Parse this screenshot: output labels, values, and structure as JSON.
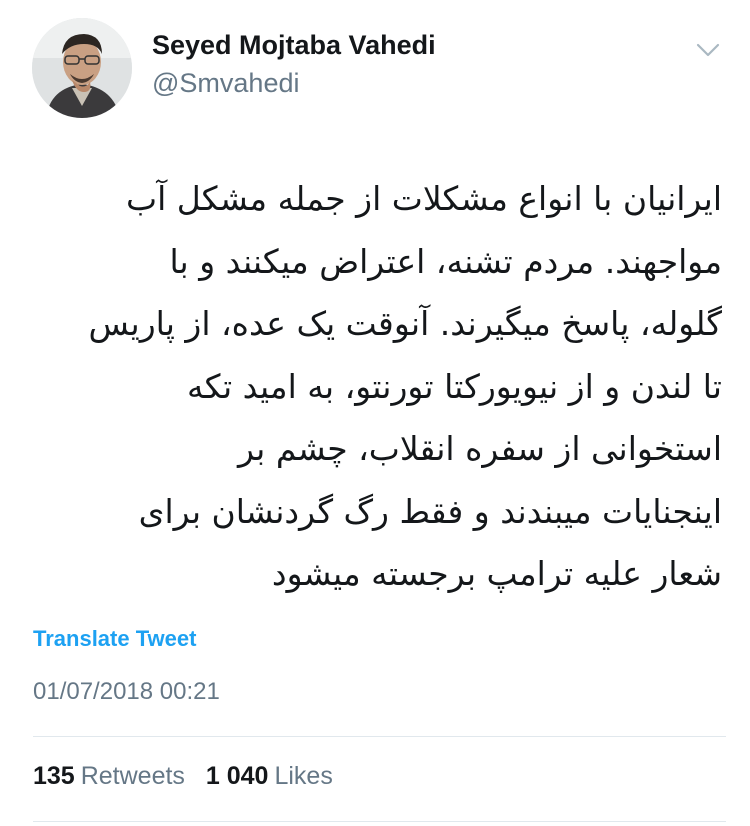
{
  "user": {
    "display_name": "Seyed Mojtaba Vahedi",
    "handle": "@Smvahedi",
    "avatar_icon": "profile-photo",
    "menu_icon": "chevron-down-icon"
  },
  "tweet": {
    "lines": [
      "ایرانیان با انواع مشکلات از جمله مشکل آب",
      "مواجهند. مردم تشنه، اعتراض میکنند و با",
      "گلوله، پاسخ میگیرند. آنوقت یک عده، از پاریس",
      "تا لندن و از نیویورکتا تورنتو، به امید تکه",
      "استخوانی از سفره انقلاب، چشم بر",
      "اینجنایات میبندند و فقط رگ گردنشان برای",
      "شعار علیه ترامپ برجسته میشود"
    ],
    "translate_label": "Translate Tweet",
    "timestamp": "01/07/2018 00:21"
  },
  "stats": {
    "retweets_count": "135",
    "retweets_label": "Retweets",
    "likes_count": "1 040",
    "likes_label": "Likes"
  },
  "colors": {
    "link": "#1da1f2",
    "secondary_text": "#657786",
    "primary_text": "#14171a",
    "divider": "#e1e8ed"
  }
}
